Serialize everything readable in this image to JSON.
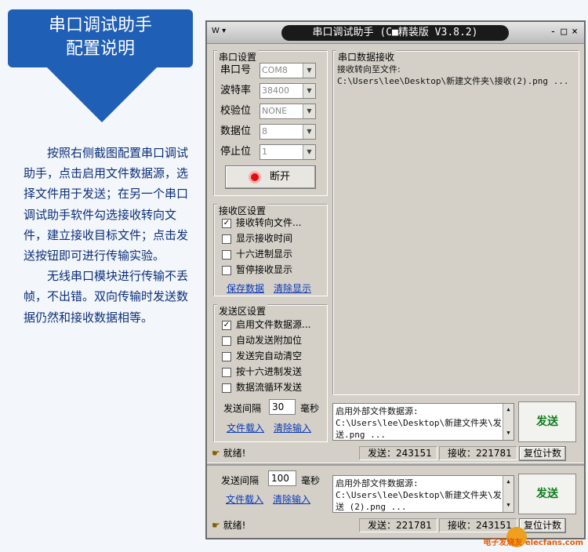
{
  "callout": {
    "line1": "串口调试助手",
    "line2": "配置说明"
  },
  "desc": {
    "p1": "按照右侧截图配置串口调试助手，点击启用文件数据源，选择文件用于发送；在另一个串口调试助手软件勾选接收转向文件，建立接收目标文件；点击发送按钮即可进行传输实验。",
    "p2": "无线串口模块进行传输不丢帧，不出错。双向传输时发送数据仍然和接收数据相等。"
  },
  "window": {
    "title": "串口调试助手 (C■精装版 V3.8.2)",
    "sys_menu": "W ▾",
    "ctrls": [
      "-",
      "□",
      "×"
    ]
  },
  "serial": {
    "group": "串口设置",
    "port_label": "串口号",
    "port": "COM8",
    "baud_label": "波特率",
    "baud": "38400",
    "parity_label": "校验位",
    "parity": "NONE",
    "data_label": "数据位",
    "data": "8",
    "stop_label": "停止位",
    "stop": "1",
    "open_btn": "断开"
  },
  "recv_settings": {
    "group": "接收区设置",
    "opt1": "接收转向文件...",
    "opt2": "显示接收时间",
    "opt3": "十六进制显示",
    "opt4": "暂停接收显示",
    "save": "保存数据",
    "clear": "清除显示"
  },
  "send_settings": {
    "group": "发送区设置",
    "opt1": "启用文件数据源...",
    "opt2": "自动发送附加位",
    "opt3": "发送完自动清空",
    "opt4": "按十六进制发送",
    "opt5": "数据流循环发送",
    "interval_label": "发送间隔",
    "interval": "30",
    "unit": "毫秒",
    "load": "文件载入",
    "clear": "清除输入"
  },
  "recv_area": {
    "group": "串口数据接收",
    "line1": "接收转向至文件:",
    "line2": "C:\\Users\\lee\\Desktop\\新建文件夹\\接收(2).png ..."
  },
  "send_area": {
    "line1": "启用外部文件数据源:",
    "line2": "C:\\Users\\lee\\Desktop\\新建文件夹\\发",
    "line3": "送.png ...",
    "send_btn": "发送"
  },
  "status": {
    "ready": "就绪!",
    "sent": "发送：243151",
    "recv": "接收：221781",
    "reset": "复位计数"
  },
  "bottom": {
    "interval_label": "发送间隔",
    "interval": "100",
    "unit": "毫秒",
    "load": "文件载入",
    "clear": "清除输入",
    "line1": "启用外部文件数据源:",
    "line2": "C:\\Users\\lee\\Desktop\\新建文件夹\\发",
    "line3": "送 (2).png ...",
    "send_btn": "发送",
    "ready": "就绪!",
    "sent": "发送：221781",
    "recv": "接收：243151",
    "reset": "复位计数"
  },
  "watermark": "电子发烧友 elecfans.com"
}
